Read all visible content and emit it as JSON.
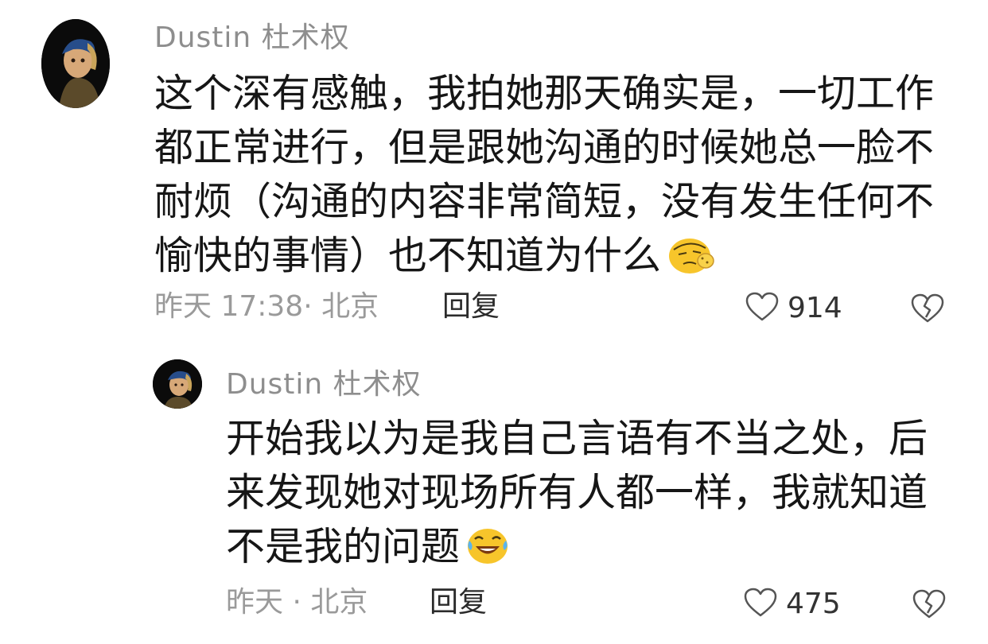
{
  "comments": [
    {
      "username": "Dustin 杜术权",
      "lines": [
        "这个深有感触，我拍她那天确实是，一切工作",
        "都正常进行，但是跟她沟通的时候她总一脸不",
        "耐烦（沟通的内容非常简短，没有发生任何不",
        "愉快的事情）也不知道为什么"
      ],
      "emoji": "face-palm-emoji",
      "meta": "昨天 17:38· 北京",
      "reply_label": "回复",
      "likes": "914"
    },
    {
      "username": "Dustin 杜术权",
      "lines": [
        "开始我以为是我自己言语有不当之处，后",
        "来发现她对现场所有人都一样，我就知道",
        "不是我的问题"
      ],
      "emoji": "laughing-tears-emoji",
      "meta": "昨天 · 北京",
      "reply_label": "回复",
      "likes": "475"
    }
  ],
  "icons": {
    "like": "heart-outline-icon",
    "dislike": "broken-heart-icon"
  },
  "colors": {
    "username": "#8e8e8e",
    "meta": "#9a9a9a",
    "text": "#161616",
    "emoji_yellow": "#f7c52b"
  }
}
